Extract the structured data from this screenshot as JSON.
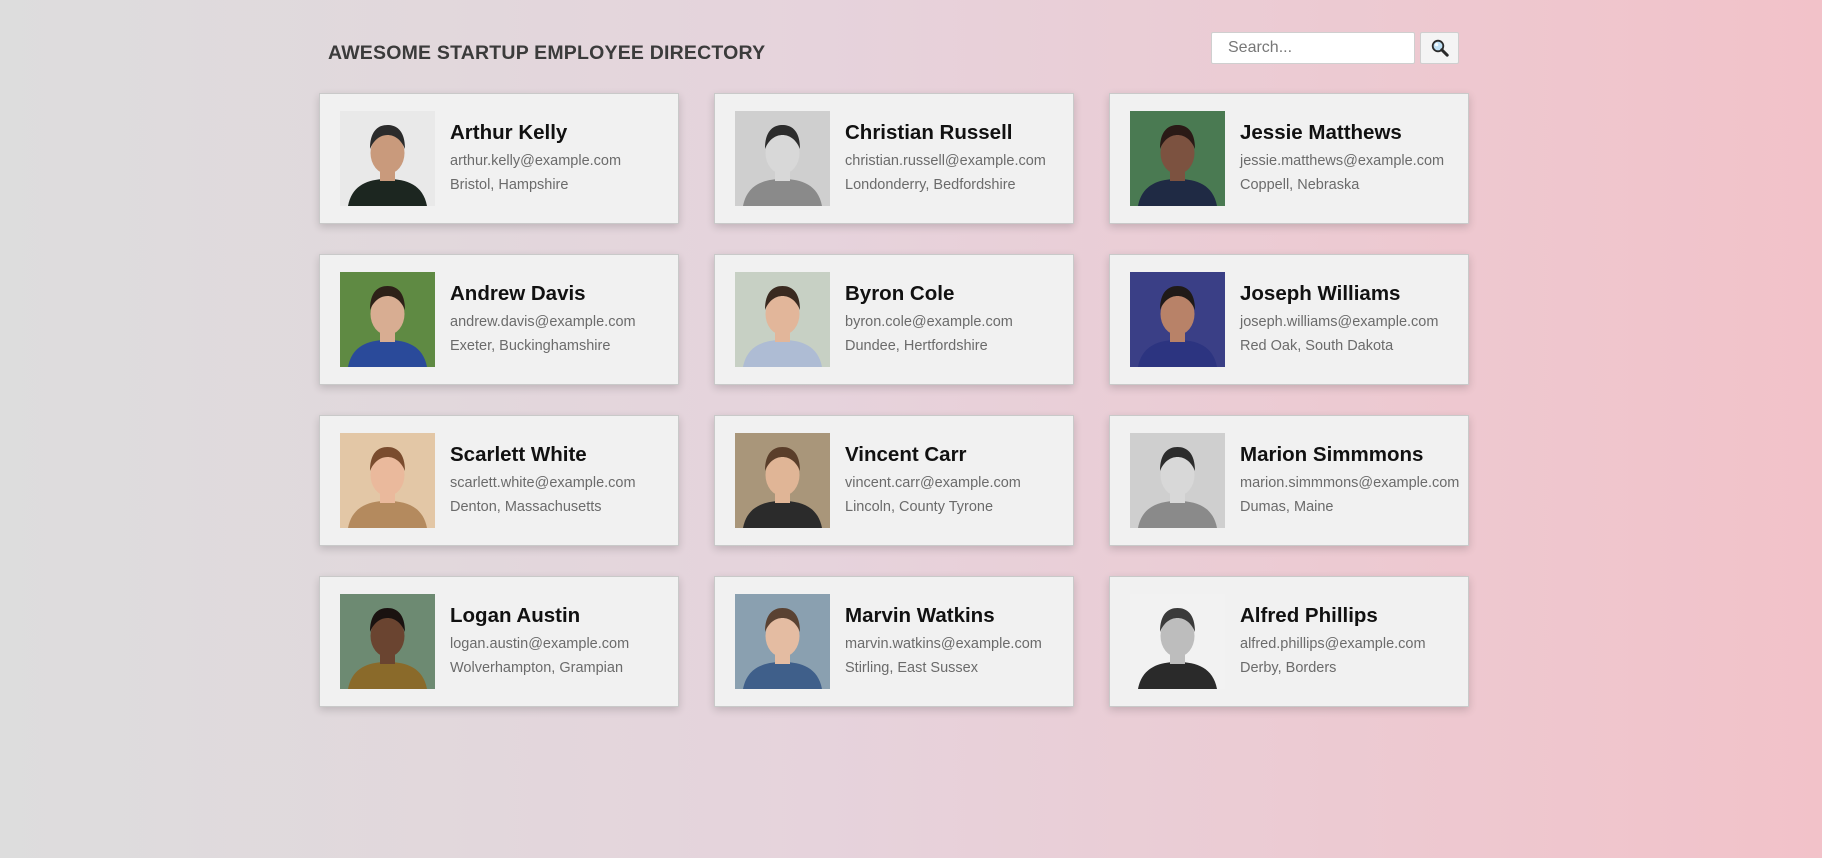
{
  "header": {
    "title": "AWESOME STARTUP EMPLOYEE DIRECTORY",
    "search_placeholder": "Search...",
    "search_icon": "magnifier-icon"
  },
  "employees": [
    {
      "name": "Arthur Kelly",
      "email": "arthur.kelly@example.com",
      "location": "Bristol, Hampshire",
      "photo": {
        "bg": "#e9e9e9",
        "skin": "#c99a7c",
        "hair": "#2b2b2b",
        "shirt": "#1c2620"
      }
    },
    {
      "name": "Christian Russell",
      "email": "christian.russell@example.com",
      "location": "Londonderry, Bedfordshire",
      "photo": {
        "bg": "#cfcfcf",
        "skin": "#d8d8d8",
        "hair": "#2c2c2c",
        "shirt": "#8a8a8a"
      }
    },
    {
      "name": "Jessie Matthews",
      "email": "jessie.matthews@example.com",
      "location": "Coppell, Nebraska",
      "photo": {
        "bg": "#4a7a52",
        "skin": "#7c5240",
        "hair": "#2a1a16",
        "shirt": "#1f2a44"
      }
    },
    {
      "name": "Andrew Davis",
      "email": "andrew.davis@example.com",
      "location": "Exeter, Buckinghamshire",
      "photo": {
        "bg": "#5f8a43",
        "skin": "#d8ad92",
        "hair": "#2d2118",
        "shirt": "#2a4a9a"
      }
    },
    {
      "name": "Byron Cole",
      "email": "byron.cole@example.com",
      "location": "Dundee, Hertfordshire",
      "photo": {
        "bg": "#c7d0c4",
        "skin": "#e2b69a",
        "hair": "#3a2a20",
        "shirt": "#aebcd4"
      }
    },
    {
      "name": "Joseph Williams",
      "email": "joseph.williams@example.com",
      "location": "Red Oak, South Dakota",
      "photo": {
        "bg": "#3a3f86",
        "skin": "#b88268",
        "hair": "#1f1a18",
        "shirt": "#2c3480"
      }
    },
    {
      "name": "Scarlett White",
      "email": "scarlett.white@example.com",
      "location": "Denton, Massachusetts",
      "photo": {
        "bg": "#e3c7a6",
        "skin": "#eab99c",
        "hair": "#7a4c2e",
        "shirt": "#b48a5e"
      }
    },
    {
      "name": "Vincent Carr",
      "email": "vincent.carr@example.com",
      "location": "Lincoln, County Tyrone",
      "photo": {
        "bg": "#a9967a",
        "skin": "#e0b596",
        "hair": "#5a3e2a",
        "shirt": "#2b2b2b"
      }
    },
    {
      "name": "Marion Simmmons",
      "email": "marion.simmmons@example.com",
      "location": "Dumas, Maine",
      "photo": {
        "bg": "#cfcfcf",
        "skin": "#d8d8d8",
        "hair": "#2c2c2c",
        "shirt": "#8a8a8a"
      }
    },
    {
      "name": "Logan Austin",
      "email": "logan.austin@example.com",
      "location": "Wolverhampton, Grampian",
      "photo": {
        "bg": "#6d8a72",
        "skin": "#6a4430",
        "hair": "#1a1210",
        "shirt": "#8a6a2a"
      }
    },
    {
      "name": "Marvin Watkins",
      "email": "marvin.watkins@example.com",
      "location": "Stirling, East Sussex",
      "photo": {
        "bg": "#8aa0b0",
        "skin": "#e4bca2",
        "hair": "#5a4232",
        "shirt": "#3f5f8a"
      }
    },
    {
      "name": "Alfred Phillips",
      "email": "alfred.phillips@example.com",
      "location": "Derby, Borders",
      "photo": {
        "bg": "#f2f2f2",
        "skin": "#bdbdbd",
        "hair": "#3a3a3a",
        "shirt": "#2a2a2a"
      }
    }
  ]
}
